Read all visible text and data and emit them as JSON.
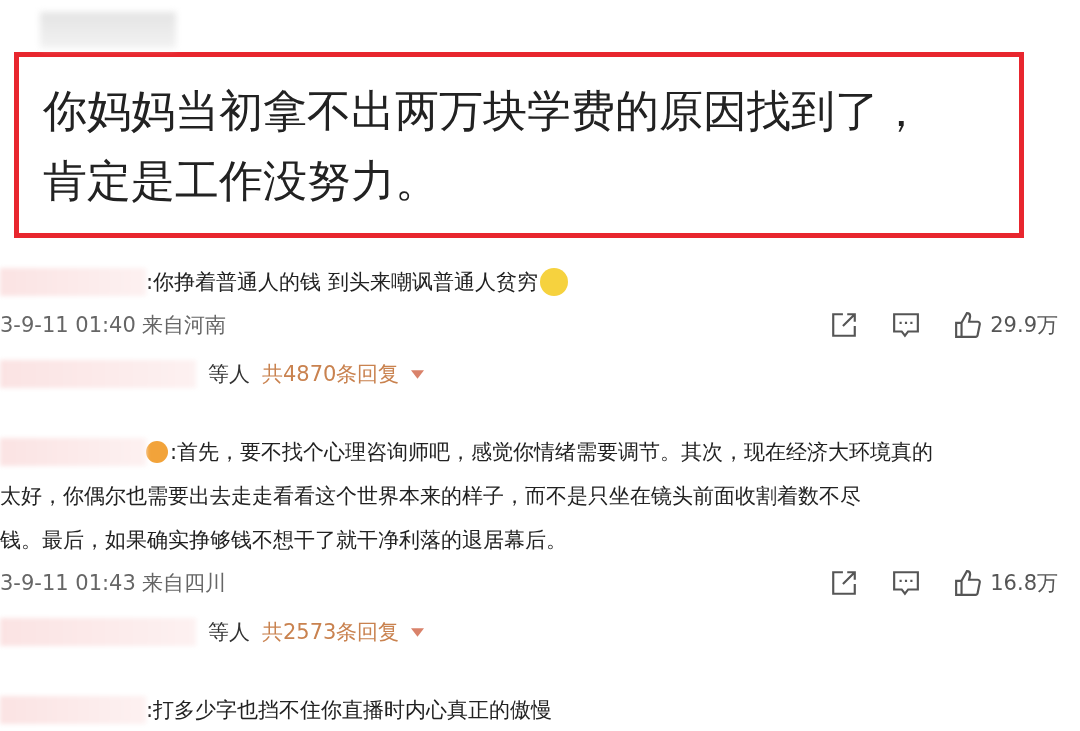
{
  "highlight": {
    "lines": [
      "你妈妈当初拿不出两万块学费的原因找到了，",
      "肯定是工作没努力。"
    ]
  },
  "comments": [
    {
      "badge": false,
      "emoji": true,
      "lines": [
        ":你挣着普通人的钱 到头来嘲讽普通人贫穷"
      ],
      "meta": "3-9-11 01:40 来自河南",
      "likes": "29.9万",
      "reply_who": "等人",
      "reply_count": "共4870条回复"
    },
    {
      "badge": true,
      "emoji": false,
      "lines": [
        ":首先，要不找个心理咨询师吧，感觉你情绪需要调节。其次，现在经济大环境真的",
        "太好，你偶尔也需要出去走走看看这个世界本来的样子，而不是只坐在镜头前面收割着数不尽",
        "钱。最后，如果确实挣够钱不想干了就干净利落的退居幕后。"
      ],
      "meta": "3-9-11 01:43 来自四川",
      "likes": "16.8万",
      "reply_who": "等人",
      "reply_count": "共2573条回复"
    },
    {
      "badge": false,
      "emoji": false,
      "lines": [
        ":打多少字也挡不住你直播时内心真正的傲慢"
      ]
    }
  ]
}
